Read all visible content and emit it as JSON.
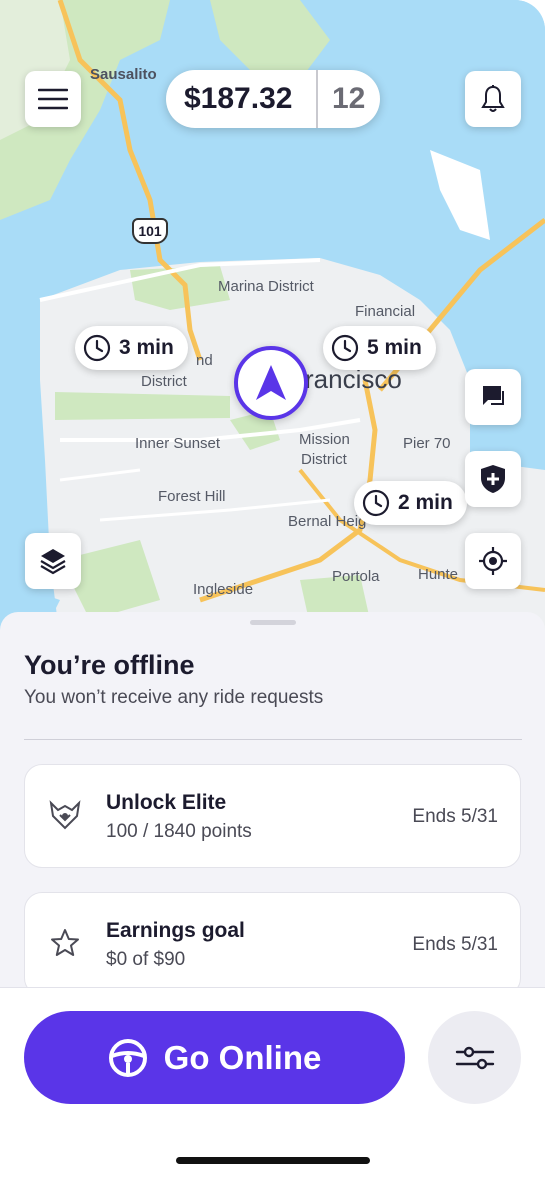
{
  "earnings": {
    "amount": "$187.32",
    "count": "12"
  },
  "map": {
    "labels": {
      "sausalito": "Sausalito",
      "highway": "101",
      "marina": "Marina District",
      "financial": "Financial",
      "district_left": "nd",
      "district_left2": "District",
      "city": "rancisco",
      "inner_sunset": "Inner Sunset",
      "mission": "Mission",
      "mission2": "District",
      "pier": "Pier 70",
      "forest_hill": "Forest Hill",
      "bernal": "Bernal Heig",
      "portola": "Portola",
      "ingleside": "Ingleside",
      "hunters": "Hunte"
    },
    "etas": [
      "3 min",
      "5 min",
      "2 min"
    ]
  },
  "status": {
    "title": "You’re offline",
    "subtitle": "You won’t receive any ride requests"
  },
  "cards": [
    {
      "icon": "elite-badge-icon",
      "title": "Unlock Elite",
      "subtitle": "100 / 1840 points",
      "end": "Ends 5/31"
    },
    {
      "icon": "star-icon",
      "title": "Earnings goal",
      "subtitle": "$0 of $90",
      "end": "Ends 5/31"
    }
  ],
  "actions": {
    "go_online": "Go Online"
  },
  "colors": {
    "accent": "#5a35e8",
    "water": "#a9dcf7",
    "land": "#eef0f2",
    "park": "#cfe8c0",
    "road": "#f7c35a"
  }
}
